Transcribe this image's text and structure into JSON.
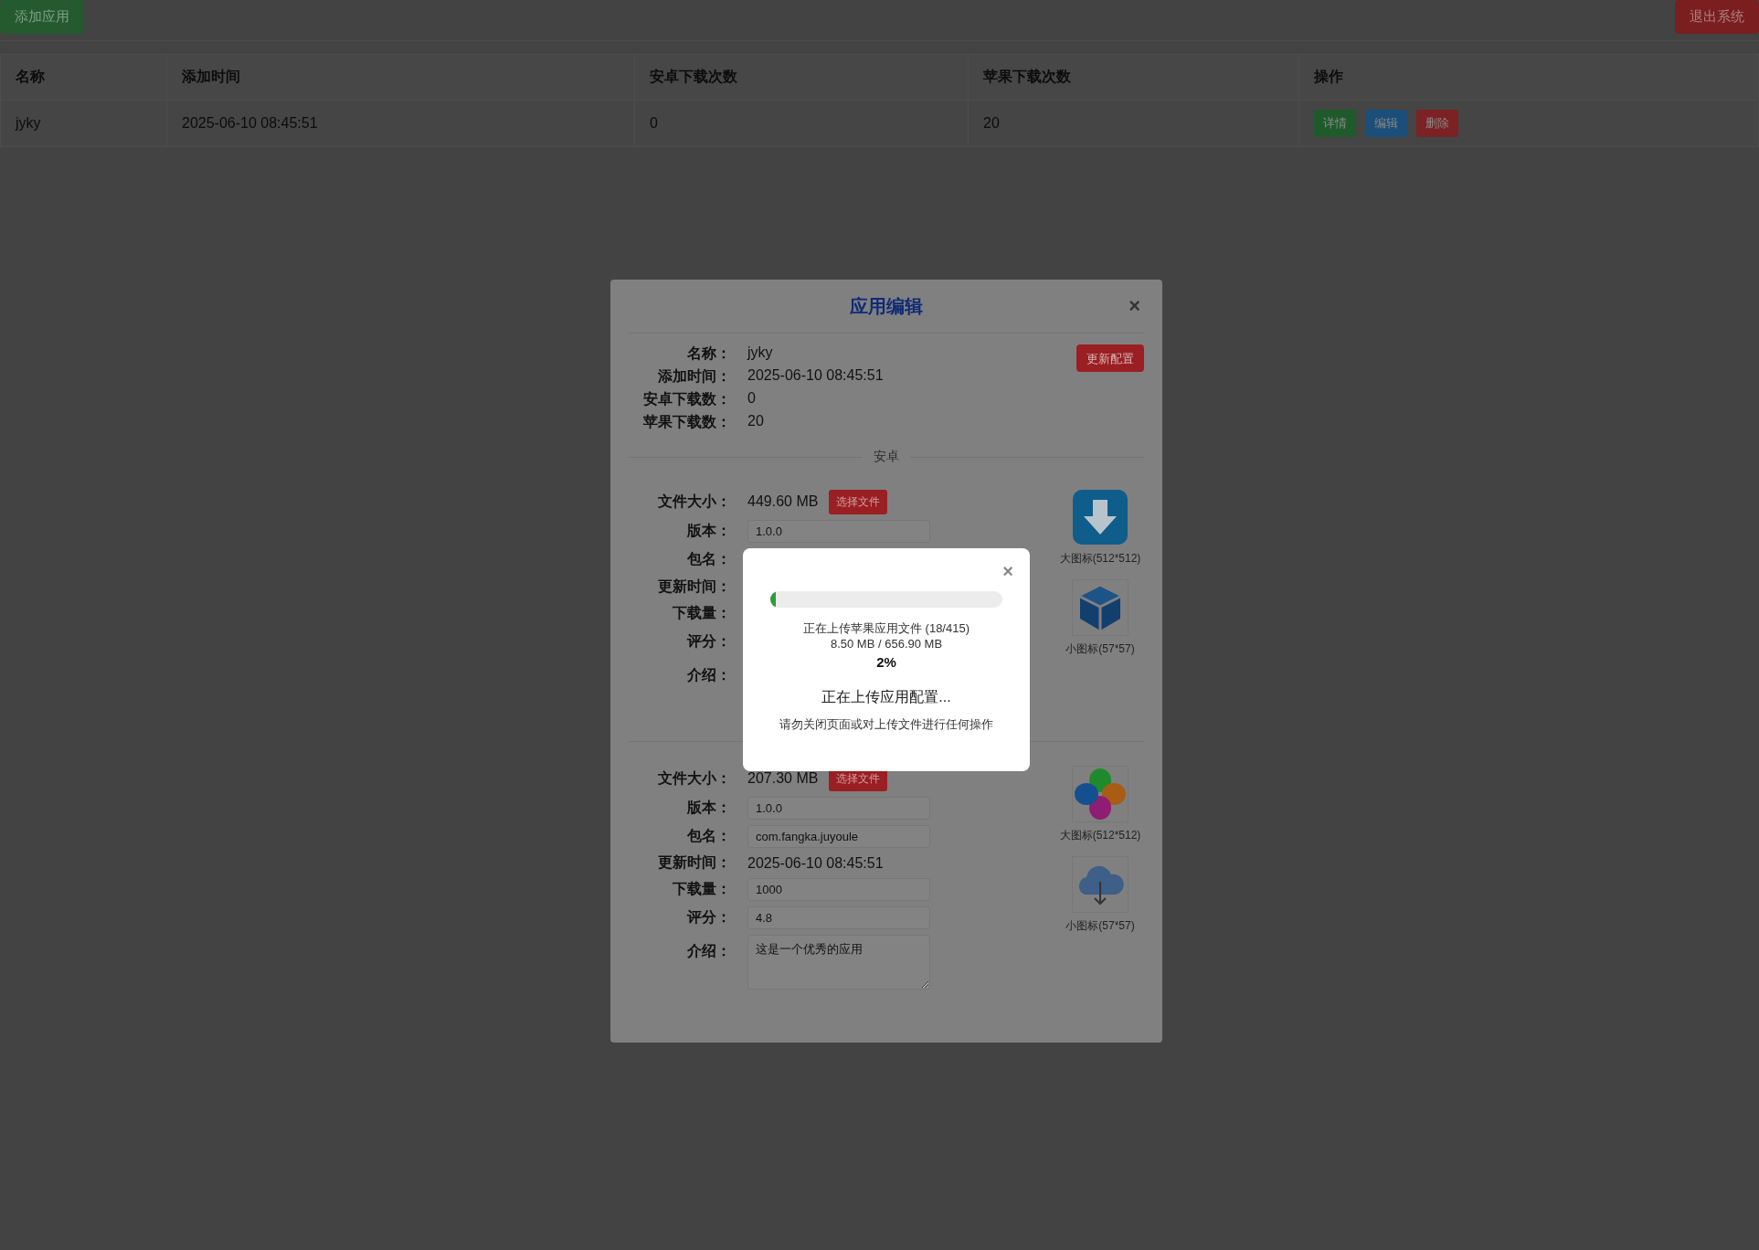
{
  "top_bar": {
    "add_button": "添加应用",
    "logout_button": "退出系统"
  },
  "table": {
    "columns": [
      "名称",
      "添加时间",
      "安卓下载次数",
      "苹果下载次数",
      "操作"
    ],
    "rows": [
      {
        "cells": [
          "jyky",
          "2025-06-10 08:45:51",
          "0",
          "20"
        ],
        "actions": [
          {
            "label": "详情",
            "color": "#1f5a2b"
          },
          {
            "label": "编辑",
            "color": "#1b4e78"
          },
          {
            "label": "删除",
            "color": "#7c2124"
          }
        ]
      }
    ]
  },
  "edit_dialog": {
    "title": "应用编辑",
    "close": "×",
    "update_button": "更新配置",
    "info": [
      {
        "label": "名称：",
        "value": "jyky"
      },
      {
        "label": "添加时间：",
        "value": "2025-06-10 08:45:51"
      },
      {
        "label": "安卓下载数：",
        "value": "0"
      },
      {
        "label": "苹果下载数：",
        "value": "20"
      }
    ],
    "sections": [
      {
        "divider": "安卓",
        "fields": [
          {
            "kind": "file",
            "label": "文件大小：",
            "value": "449.60 MB",
            "button": "选择文件"
          },
          {
            "kind": "input",
            "label": "版本：",
            "value": "1.0.0"
          },
          {
            "kind": "input",
            "label": "包名："
          },
          {
            "kind": "text",
            "label": "更新时间："
          },
          {
            "kind": "input",
            "label": "下载量："
          },
          {
            "kind": "input",
            "label": "评分："
          },
          {
            "kind": "textarea",
            "label": "介绍："
          }
        ],
        "icons": [
          {
            "kind": "download",
            "caption": "大图标(512*512)"
          },
          {
            "kind": "cube",
            "caption": "小图标(57*57)"
          }
        ]
      },
      {
        "fields": [
          {
            "kind": "file",
            "label": "文件大小：",
            "value": "207.30 MB",
            "button": "选择文件"
          },
          {
            "kind": "input",
            "label": "版本：",
            "value": "1.0.0"
          },
          {
            "kind": "input",
            "label": "包名：",
            "value": "com.fangka.juyoule"
          },
          {
            "kind": "text",
            "label": "更新时间：",
            "value": "2025-06-10 08:45:51"
          },
          {
            "kind": "input",
            "label": "下载量：",
            "value": "1000"
          },
          {
            "kind": "input",
            "label": "评分：",
            "value": "4.8"
          },
          {
            "kind": "textarea",
            "label": "介绍：",
            "value": "这是一个优秀的应用"
          }
        ],
        "icons": [
          {
            "kind": "clover",
            "caption": "大图标(512*512)"
          },
          {
            "kind": "cloud",
            "caption": "小图标(57*57)"
          }
        ]
      }
    ]
  },
  "upload_dialog": {
    "close": "×",
    "level": 0.02,
    "status": "正在上传苹果应用文件 (18/415)",
    "size": "8.50 MB / 656.90 MB",
    "percent": "2%",
    "message": "正在上传应用配置...",
    "warning": "请勿关闭页面或对上传文件进行任何操作"
  }
}
